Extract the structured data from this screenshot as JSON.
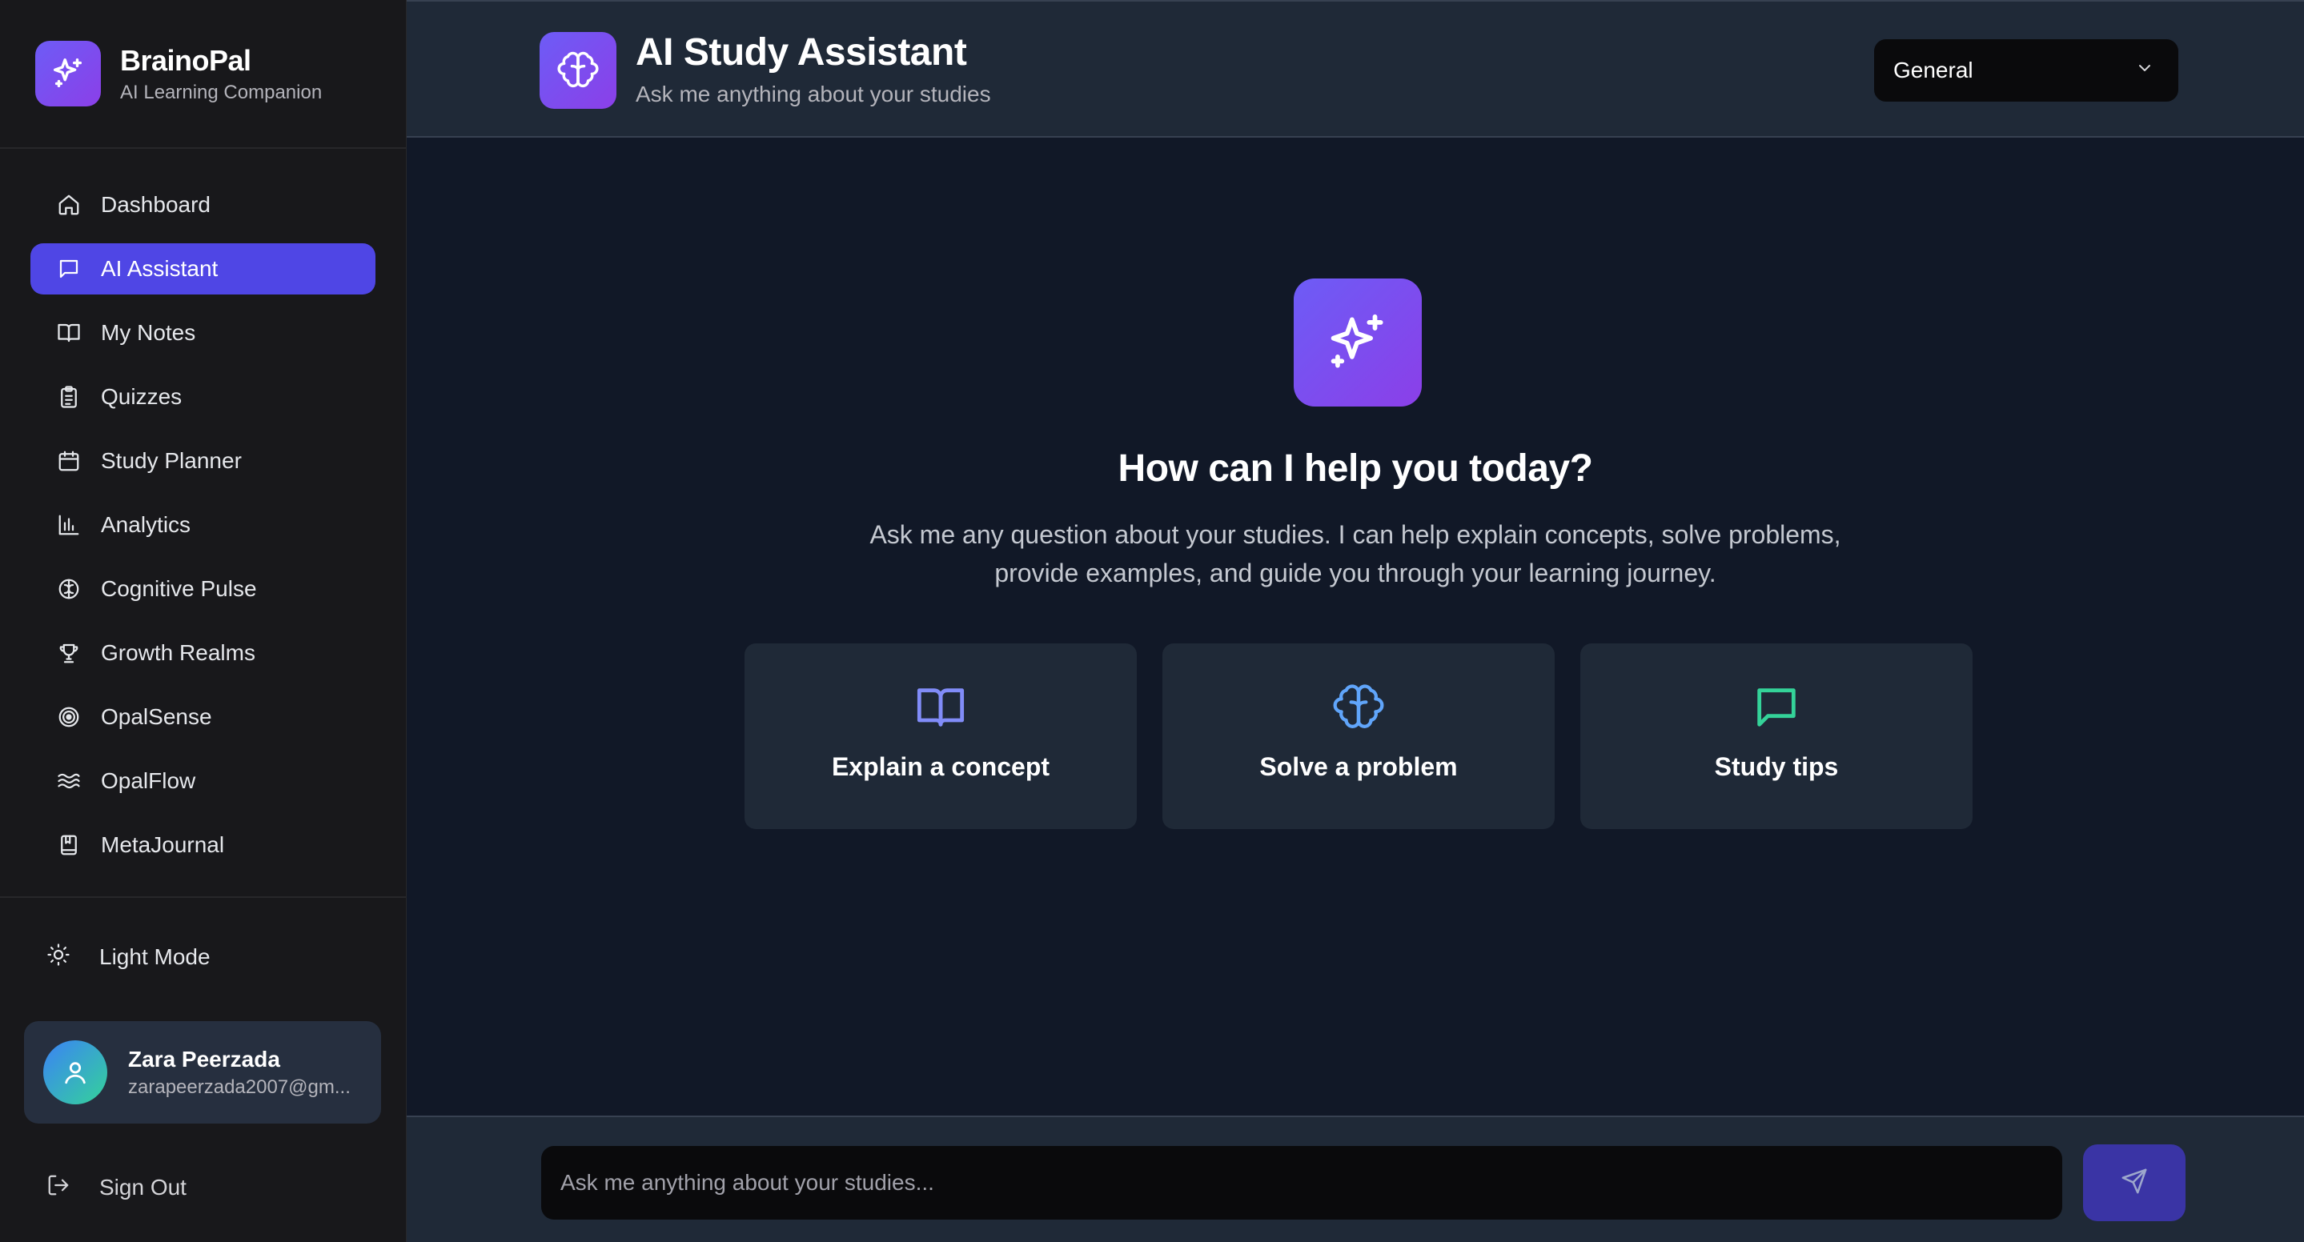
{
  "brand": {
    "name": "BrainoPal",
    "subtitle": "AI Learning Companion"
  },
  "sidebar": {
    "items": [
      {
        "label": "Dashboard",
        "icon": "home-icon",
        "active": false
      },
      {
        "label": "AI Assistant",
        "icon": "message-icon",
        "active": true
      },
      {
        "label": "My Notes",
        "icon": "book-icon",
        "active": false
      },
      {
        "label": "Quizzes",
        "icon": "clipboard-icon",
        "active": false
      },
      {
        "label": "Study Planner",
        "icon": "calendar-icon",
        "active": false
      },
      {
        "label": "Analytics",
        "icon": "bar-chart-icon",
        "active": false
      },
      {
        "label": "Cognitive Pulse",
        "icon": "brain-icon",
        "active": false
      },
      {
        "label": "Growth Realms",
        "icon": "trophy-icon",
        "active": false
      },
      {
        "label": "OpalSense",
        "icon": "target-icon",
        "active": false
      },
      {
        "label": "OpalFlow",
        "icon": "waves-icon",
        "active": false
      },
      {
        "label": "MetaJournal",
        "icon": "journal-icon",
        "active": false
      }
    ],
    "theme_toggle_label": "Light Mode",
    "user": {
      "name": "Zara Peerzada",
      "email": "zarapeerzada2007@gm..."
    },
    "sign_out_label": "Sign Out"
  },
  "header": {
    "title": "AI Study Assistant",
    "subtitle": "Ask me anything about your studies",
    "subject_select": {
      "value": "General"
    }
  },
  "hero": {
    "title": "How can I help you today?",
    "description_line1": "Ask me any question about your studies. I can help explain concepts, solve problems,",
    "description_line2": "provide examples, and guide you through your learning journey."
  },
  "quick_actions": [
    {
      "label": "Explain a concept",
      "icon": "book-open-icon",
      "color": "#818cf8"
    },
    {
      "label": "Solve a problem",
      "icon": "brain-icon",
      "color": "#60a5fa"
    },
    {
      "label": "Study tips",
      "icon": "message-square-icon",
      "color": "#34d399"
    }
  ],
  "chat": {
    "placeholder": "Ask me anything about your studies..."
  },
  "colors": {
    "accent": "#4f46e5",
    "gradient_start": "#6d5cf6",
    "gradient_end": "#8b3fe8",
    "sidebar_bg": "#18181b",
    "main_bg": "#111827",
    "panel_bg": "#1f2937"
  }
}
